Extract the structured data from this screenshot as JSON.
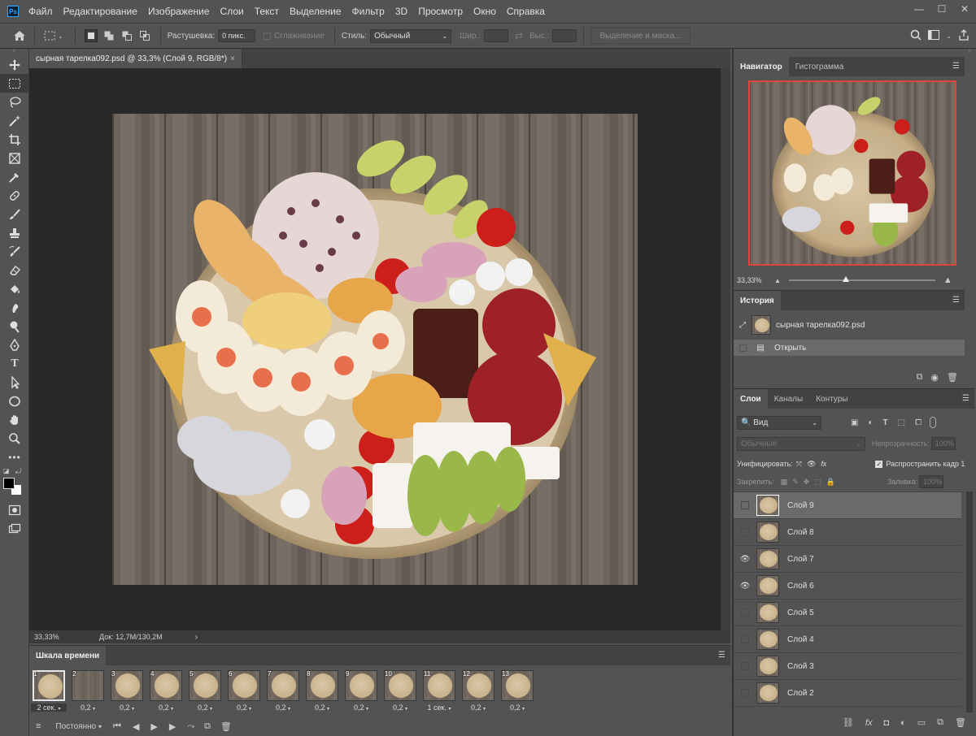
{
  "app": {
    "logo": "Ps"
  },
  "menu": [
    "Файл",
    "Редактирование",
    "Изображение",
    "Слои",
    "Текст",
    "Выделение",
    "Фильтр",
    "3D",
    "Просмотр",
    "Окно",
    "Справка"
  ],
  "window_controls": {
    "minimize": "—",
    "maximize": "☐",
    "close": "✕"
  },
  "options": {
    "feather_label": "Растушевка:",
    "feather_value": "0 пикс.",
    "antialias_label": "Сглаживание",
    "style_label": "Стиль:",
    "style_value": "Обычный",
    "width_label": "Шир.:",
    "height_label": "Выс.:",
    "select_mask_button": "Выделение и маска..."
  },
  "document": {
    "tab_title": "сырная тарелка092.psd @ 33,3% (Слой 9, RGB/8*)",
    "tab_close": "×",
    "zoom": "33,33%",
    "doc_info": "Док: 12,7M/130,2M",
    "status_arrow": "›"
  },
  "timeline": {
    "tab": "Шкала времени",
    "frames": [
      {
        "num": "1",
        "delay": "2 сек.",
        "selected": true
      },
      {
        "num": "2",
        "delay": "0,2"
      },
      {
        "num": "3",
        "delay": "0,2"
      },
      {
        "num": "4",
        "delay": "0,2"
      },
      {
        "num": "5",
        "delay": "0,2"
      },
      {
        "num": "6",
        "delay": "0,2"
      },
      {
        "num": "7",
        "delay": "0,2"
      },
      {
        "num": "8",
        "delay": "0,2"
      },
      {
        "num": "9",
        "delay": "0,2"
      },
      {
        "num": "10",
        "delay": "0,2"
      },
      {
        "num": "11",
        "delay": "1 сек."
      },
      {
        "num": "12",
        "delay": "0,2"
      },
      {
        "num": "13",
        "delay": "0,2"
      }
    ],
    "loop": "Постоянно"
  },
  "navigator": {
    "tabs": [
      "Навигатор",
      "Гистограмма"
    ],
    "zoom": "33,33%"
  },
  "history": {
    "tab": "История",
    "snapshot": "сырная тарелка092.psd",
    "step": "Открыть"
  },
  "layers": {
    "tabs": [
      "Слои",
      "Каналы",
      "Контуры"
    ],
    "filter": "Вид",
    "blend_mode": "Обычные",
    "opacity_label": "Непрозрачность:",
    "opacity_value": "100%",
    "unify_label": "Унифицировать:",
    "propagate_label": "Распространить кадр 1",
    "lock_label": "Закрепить:",
    "fill_label": "Заливка:",
    "fill_value": "100%",
    "items": [
      {
        "name": "Слой 9",
        "visible": false,
        "selected": true
      },
      {
        "name": "Слой 8",
        "visible": false
      },
      {
        "name": "Слой 7",
        "visible": true
      },
      {
        "name": "Слой 6",
        "visible": true
      },
      {
        "name": "Слой 5",
        "visible": false
      },
      {
        "name": "Слой 4",
        "visible": false
      },
      {
        "name": "Слой 3",
        "visible": false
      },
      {
        "name": "Слой 2",
        "visible": false
      }
    ]
  },
  "colors": {
    "panel_bg": "#535353",
    "dark_bg": "#282828",
    "navigator_frame": "#e0443c"
  }
}
